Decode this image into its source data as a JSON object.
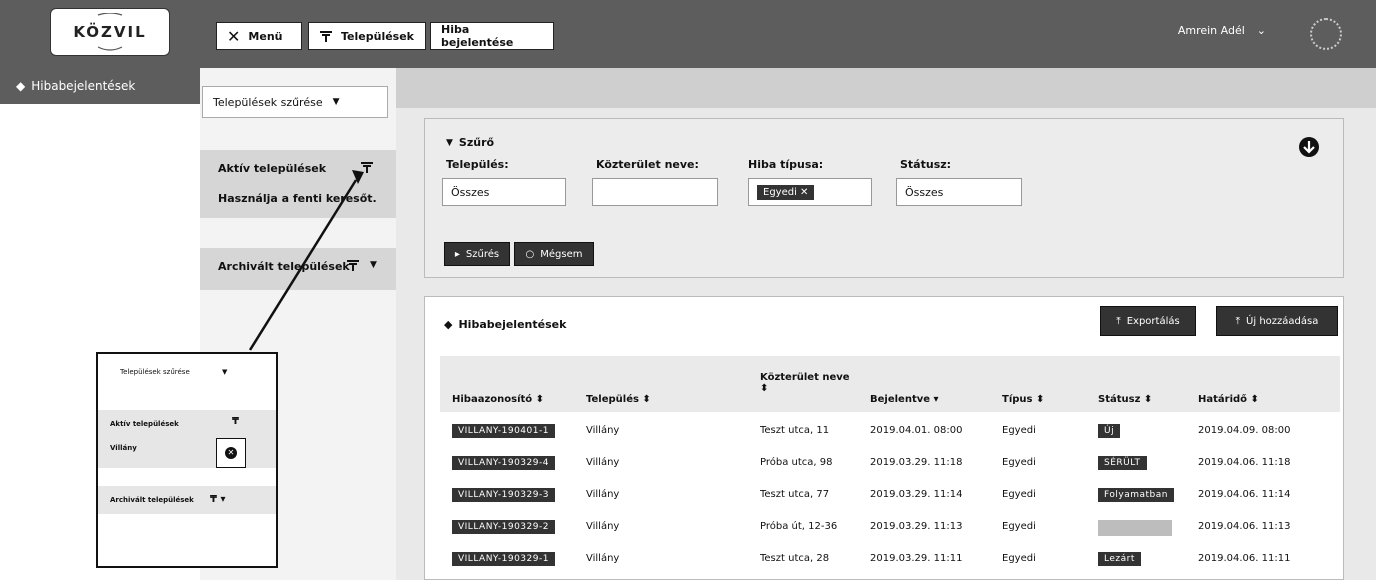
{
  "header": {
    "logo_text": "KÖZVIL",
    "menu_label": "Menü",
    "settlements_label": "Települések",
    "report_label": "Hiba bejelentése",
    "user_name": "Amrein Adél",
    "user_caret": "⌄"
  },
  "sidebar": {
    "title": "Hibabejelentések"
  },
  "settlement_filter": {
    "select_label": "Települések szűrése",
    "active_title": "Aktív települések",
    "hint": "Használja a fenti keresőt.",
    "archived_title": "Archivált települések"
  },
  "filter": {
    "title": "Szűrő",
    "settlement_label": "Település:",
    "settlement_value": "Összes",
    "street_label": "Közterület neve:",
    "street_value": "",
    "type_label": "Hiba típusa:",
    "type_value": "Egyedi",
    "status_label": "Státusz:",
    "status_value": "Összes",
    "apply_label": "Szűrés",
    "cancel_label": "Mégsem"
  },
  "reports": {
    "title": "Hibabejelentések",
    "export_label": "Exportálás",
    "add_label": "Új hozzáadása",
    "columns": [
      "Hibaazonosító",
      "Település",
      "Közterület neve",
      "Bejelentve",
      "Típus",
      "Státusz",
      "Határidő"
    ],
    "rows": [
      {
        "id": "VILLANY-190401-1",
        "town": "Villány",
        "street": "Teszt utca, 11",
        "reported": "2019.04.01. 08:00",
        "type": "Egyedi",
        "status": "Új",
        "deadline": "2019.04.09. 08:00"
      },
      {
        "id": "VILLANY-190329-4",
        "town": "Villány",
        "street": "Próba utca, 98",
        "reported": "2019.03.29. 11:18",
        "type": "Egyedi",
        "status": "SÉRÜLT",
        "deadline": "2019.04.06. 11:18"
      },
      {
        "id": "VILLANY-190329-3",
        "town": "Villány",
        "street": "Teszt utca, 77",
        "reported": "2019.03.29. 11:14",
        "type": "Egyedi",
        "status": "Folyamatban",
        "deadline": "2019.04.06. 11:14"
      },
      {
        "id": "VILLANY-190329-2",
        "town": "Villány",
        "street": "Próba út, 12-36",
        "reported": "2019.03.29. 11:13",
        "type": "Egyedi",
        "status": "",
        "deadline": "2019.04.06. 11:13"
      },
      {
        "id": "VILLANY-190329-1",
        "town": "Villány",
        "street": "Teszt utca, 28",
        "reported": "2019.03.29. 11:11",
        "type": "Egyedi",
        "status": "Lezárt",
        "deadline": "2019.04.06. 11:11"
      }
    ]
  },
  "inset": {
    "select_label": "Települések szűrése",
    "active_title": "Aktív települések",
    "item": "Villány",
    "archived_title": "Archivált települések"
  }
}
